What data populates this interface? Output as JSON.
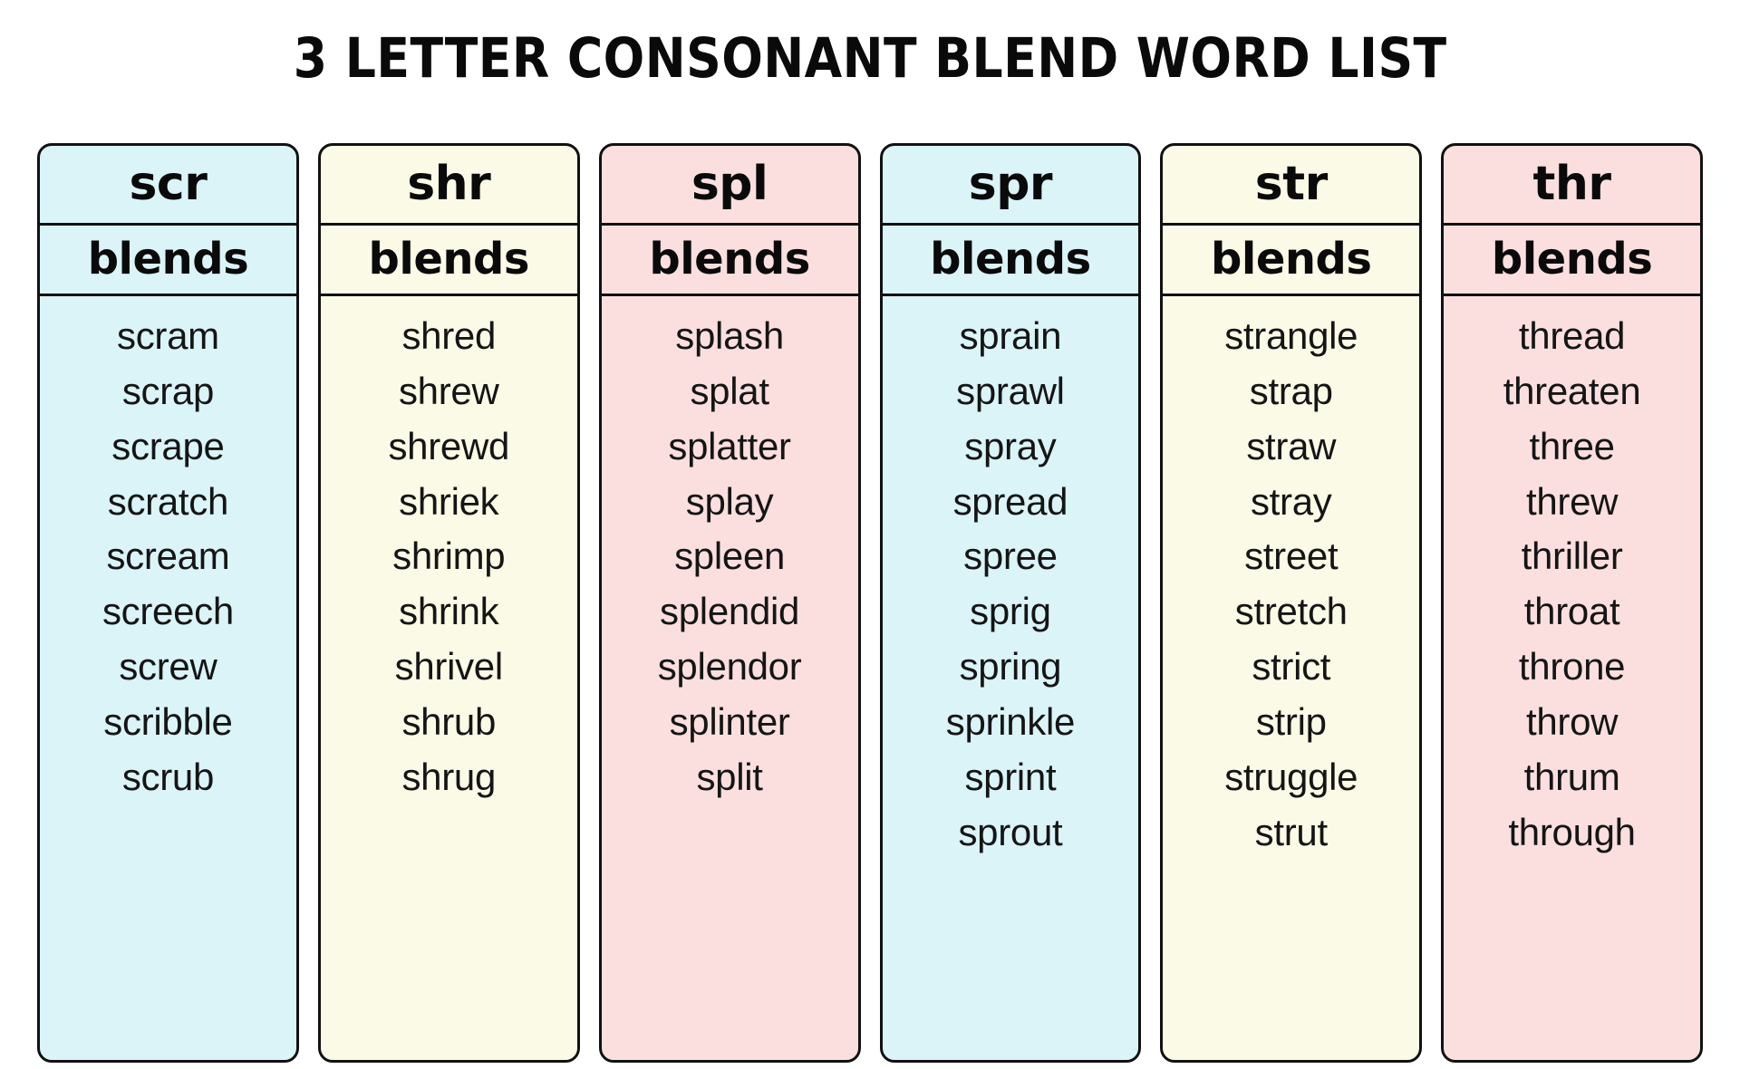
{
  "title": "3 LETTER CONSONANT BLEND WORD LIST",
  "subtitle_label": "blends",
  "colors": {
    "blue": "#daf4f8",
    "cream": "#fbfae6",
    "pink": "#fbdfdf",
    "border": "#111111",
    "text": "#151515"
  },
  "columns": [
    {
      "blend": "scr",
      "subtitle": "blends",
      "bg": "#daf4f8",
      "words": [
        "scram",
        "scrap",
        "scrape",
        "scratch",
        "scream",
        "screech",
        "screw",
        "scribble",
        "scrub"
      ]
    },
    {
      "blend": "shr",
      "subtitle": "blends",
      "bg": "#fbfae6",
      "words": [
        "shred",
        "shrew",
        "shrewd",
        "shriek",
        "shrimp",
        "shrink",
        "shrivel",
        "shrub",
        "shrug"
      ]
    },
    {
      "blend": "spl",
      "subtitle": "blends",
      "bg": "#fbdfdf",
      "words": [
        "splash",
        "splat",
        "splatter",
        "splay",
        "spleen",
        "splendid",
        "splendor",
        "splinter",
        "split"
      ]
    },
    {
      "blend": "spr",
      "subtitle": "blends",
      "bg": "#daf4f8",
      "words": [
        "sprain",
        "sprawl",
        "spray",
        "spread",
        "spree",
        "sprig",
        "spring",
        "sprinkle",
        "sprint",
        "sprout"
      ]
    },
    {
      "blend": "str",
      "subtitle": "blends",
      "bg": "#fbfae6",
      "words": [
        "strangle",
        "strap",
        "straw",
        "stray",
        "street",
        "stretch",
        "strict",
        "strip",
        "struggle",
        "strut"
      ]
    },
    {
      "blend": "thr",
      "subtitle": "blends",
      "bg": "#fbdfdf",
      "words": [
        "thread",
        "threaten",
        "three",
        "threw",
        "thriller",
        "throat",
        "throne",
        "throw",
        "thrum",
        "through"
      ]
    }
  ]
}
